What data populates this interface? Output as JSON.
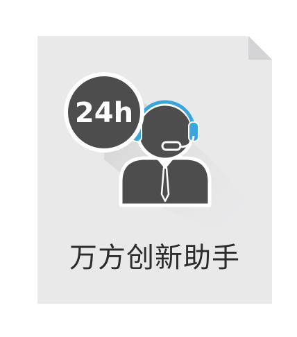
{
  "badge": {
    "text": "24h"
  },
  "caption": {
    "text": "万方创新助手"
  },
  "colors": {
    "page_background": "#ffffff",
    "card": "#e9e9ea",
    "fold": "#d4d4d6",
    "figure": "#4d4d4d",
    "outline": "#ffffff",
    "headset": "#3aa5dc",
    "caption_text": "#2b2b2b"
  },
  "icons": [
    "document-card",
    "clock-badge-24h",
    "customer-service-agent-icon",
    "headset-icon",
    "necktie-icon"
  ]
}
